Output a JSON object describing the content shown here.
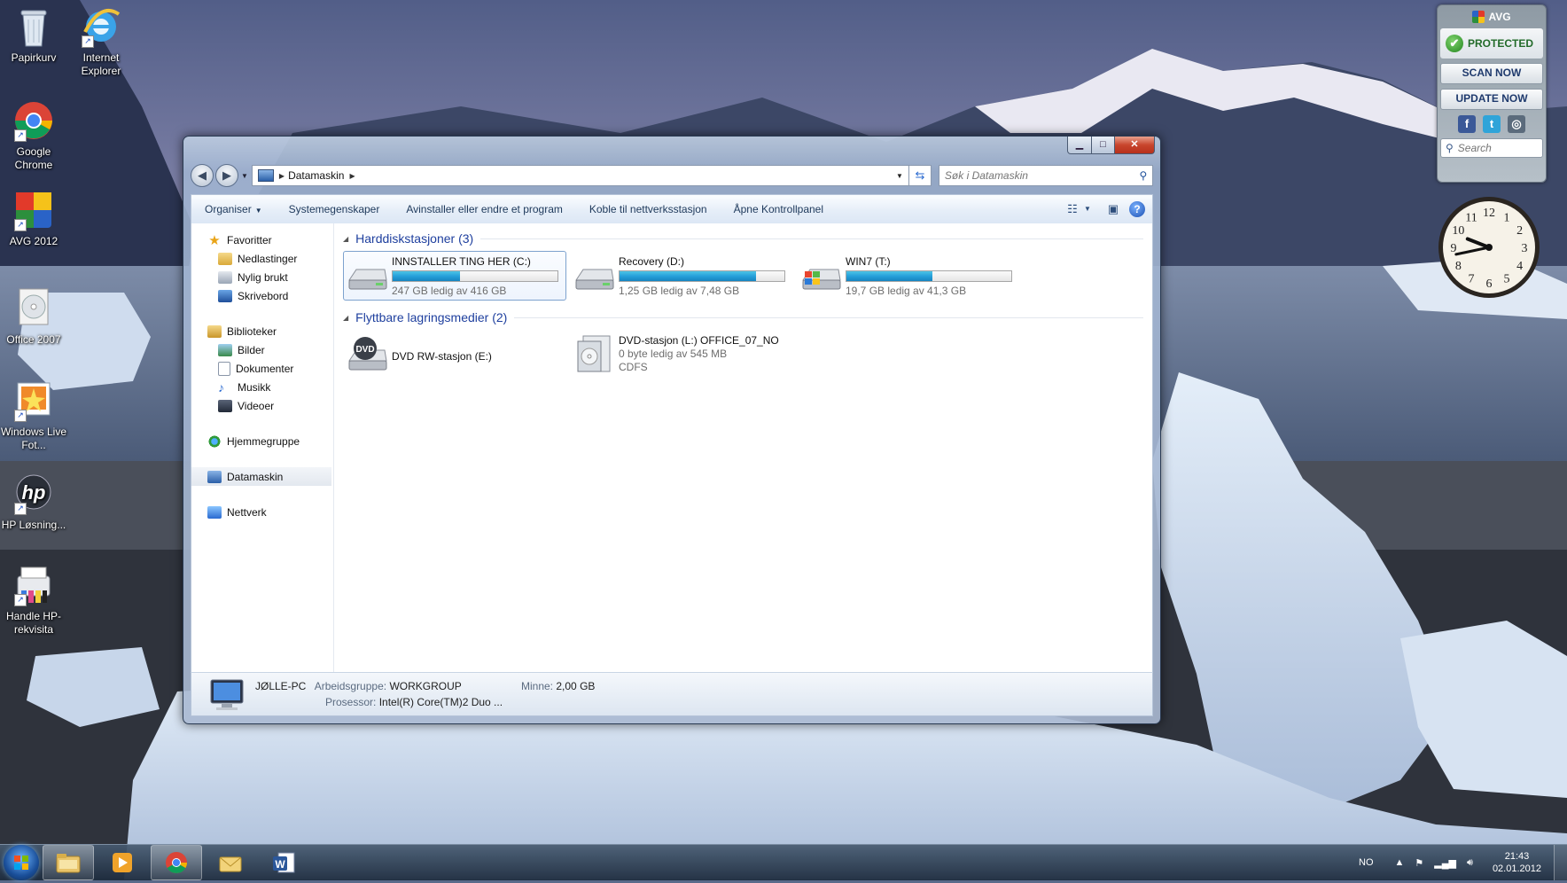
{
  "desktop": {
    "icons": [
      {
        "label": "Papirkurv"
      },
      {
        "label": "Internet Explorer"
      },
      {
        "label": "Google Chrome"
      },
      {
        "label": "AVG 2012"
      },
      {
        "label": "Office 2007"
      },
      {
        "label": "Windows Live Fot..."
      },
      {
        "label": "HP Løsning..."
      },
      {
        "label": "Handle HP-rekvisita"
      }
    ]
  },
  "window": {
    "address": {
      "crumb": "Datamaskin"
    },
    "search_placeholder": "Søk i Datamaskin",
    "toolbar": {
      "organize": "Organiser",
      "system_props": "Systemegenskaper",
      "uninstall": "Avinstaller eller endre et program",
      "map_drive": "Koble til nettverksstasjon",
      "control_panel": "Åpne Kontrollpanel"
    },
    "nav": {
      "favorites": "Favoritter",
      "downloads": "Nedlastinger",
      "recent": "Nylig brukt",
      "desktop": "Skrivebord",
      "libraries": "Biblioteker",
      "pictures": "Bilder",
      "documents": "Dokumenter",
      "music": "Musikk",
      "videos": "Videoer",
      "homegroup": "Hjemmegruppe",
      "computer": "Datamaskin",
      "network": "Nettverk"
    },
    "groups": {
      "hdd_title": "Harddiskstasjoner (3)",
      "removable_title": "Flyttbare lagringsmedier (2)"
    },
    "drives": [
      {
        "name": "INNSTALLER TING HER (C:)",
        "space": "247 GB ledig av 416 GB",
        "used_fraction": 0.41
      },
      {
        "name": "Recovery (D:)",
        "space": "1,25 GB ledig av 7,48 GB",
        "used_fraction": 0.83
      },
      {
        "name": "WIN7 (T:)",
        "space": "19,7 GB ledig av 41,3 GB",
        "used_fraction": 0.52
      }
    ],
    "removable": [
      {
        "name": "DVD RW-stasjon (E:)"
      },
      {
        "name": "DVD-stasjon (L:) OFFICE_07_NO",
        "space": "0 byte ledig av 545 MB",
        "fs": "CDFS"
      }
    ],
    "details": {
      "computer_name": "JØLLE-PC",
      "workgroup_label": "Arbeidsgruppe:",
      "workgroup": "WORKGROUP",
      "memory_label": "Minne:",
      "memory": "2,00 GB",
      "processor_label": "Prosessor:",
      "processor": "Intel(R) Core(TM)2 Duo ..."
    }
  },
  "avg": {
    "brand": "AVG",
    "status": "PROTECTED",
    "scan": "SCAN NOW",
    "update": "UPDATE NOW",
    "search_placeholder": "Search"
  },
  "clock": {
    "time": "21:43",
    "numerals": [
      "12",
      "1",
      "2",
      "3",
      "4",
      "5",
      "6",
      "7",
      "8",
      "9",
      "10",
      "11"
    ]
  },
  "taskbar": {
    "language": "NO",
    "time": "21:43",
    "date": "02.01.2012"
  }
}
